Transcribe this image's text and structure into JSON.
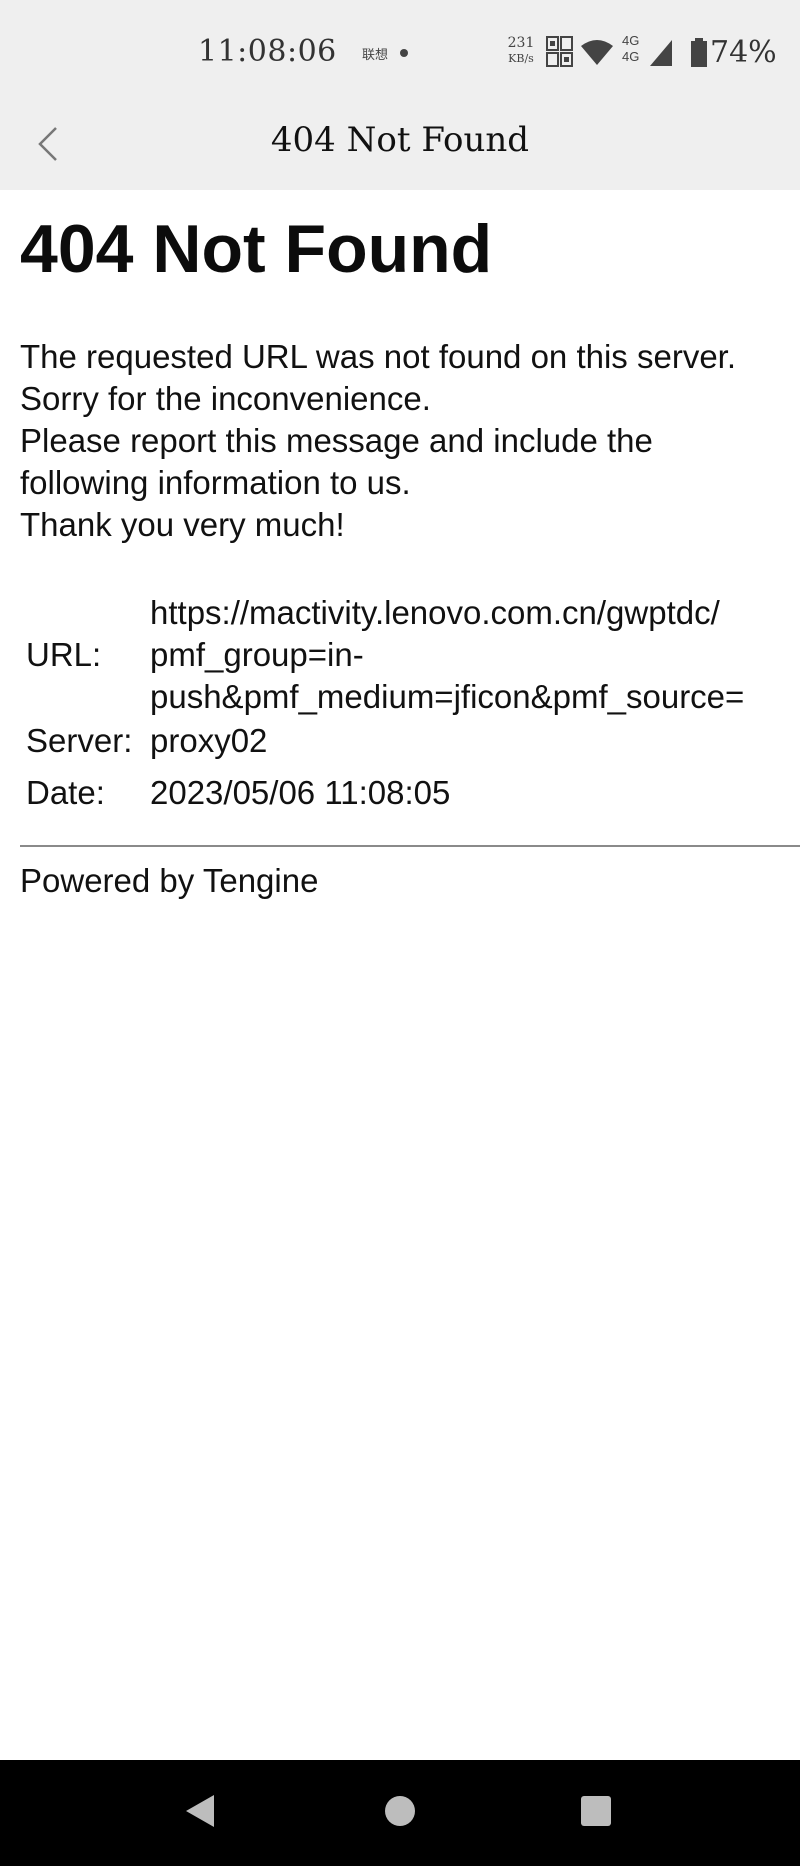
{
  "status_bar": {
    "time": "11:08:06",
    "carrier": "联想",
    "speed_value": "231",
    "speed_unit": "KB/s",
    "net_top": "4G",
    "net_bottom": "4G",
    "battery": "74%"
  },
  "navbar": {
    "title": "404 Not Found"
  },
  "page": {
    "heading": "404 Not Found",
    "message_lines": [
      "The requested URL was not found on this server.",
      "Sorry for the inconvenience.",
      "Please report this message and include the",
      "following information to us.",
      "Thank you very much!"
    ],
    "info": {
      "url_label": "URL:",
      "url_lines": [
        "https://mactivity.lenovo.com.cn/gwptdc/",
        "pmf_group=in-",
        "push&pmf_medium=jficon&pmf_source="
      ],
      "server_label": "Server:",
      "server_value": "proxy02",
      "date_label": "Date:",
      "date_value": "2023/05/06 11:08:05"
    },
    "footer": "Powered by Tengine"
  },
  "colors": {
    "chrome_bg": "#efefef",
    "page_bg": "#ffffff",
    "sysnav_bg": "#000000"
  }
}
